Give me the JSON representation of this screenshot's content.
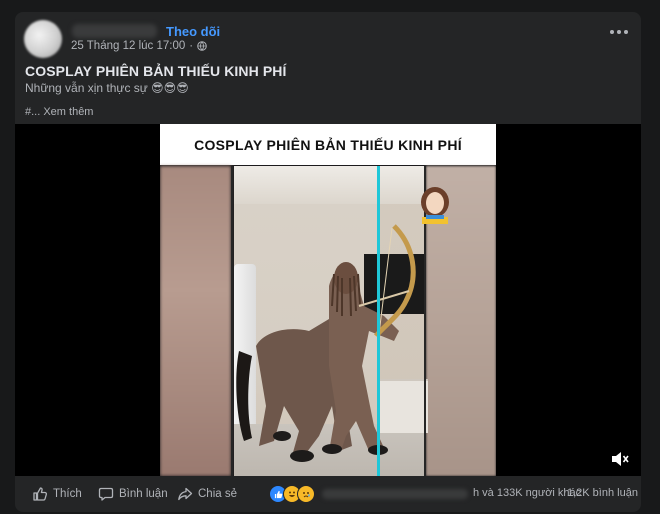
{
  "post": {
    "follow_label": "Theo dõi",
    "timestamp": "25 Tháng 12 lúc 17:00",
    "privacy_icon": "globe-icon",
    "title": "COSPLAY PHIÊN BẢN THIẾU KINH PHÍ",
    "caption_text": "Những vẫn xịn thực sự",
    "caption_emojis": "😎😎😎",
    "hashtags": "#... Xem thêm"
  },
  "video": {
    "overlay_title": "COSPLAY PHIÊN BẢN THIẾU  KINH PHÍ",
    "mute_icon": "volume-mute-icon"
  },
  "footer": {
    "like_label": "Thích",
    "comment_label": "Bình luận",
    "share_label": "Chia sẻ",
    "reactions": [
      "like",
      "haha",
      "sad"
    ],
    "others_text": "h và 133K người khác",
    "comments_count": "1,2K bình luận"
  },
  "colors": {
    "accent": "#4599ff",
    "card": "#242526",
    "page": "#18191a",
    "like_blue": "#2d88ff",
    "haha_yellow": "#f7b928"
  }
}
